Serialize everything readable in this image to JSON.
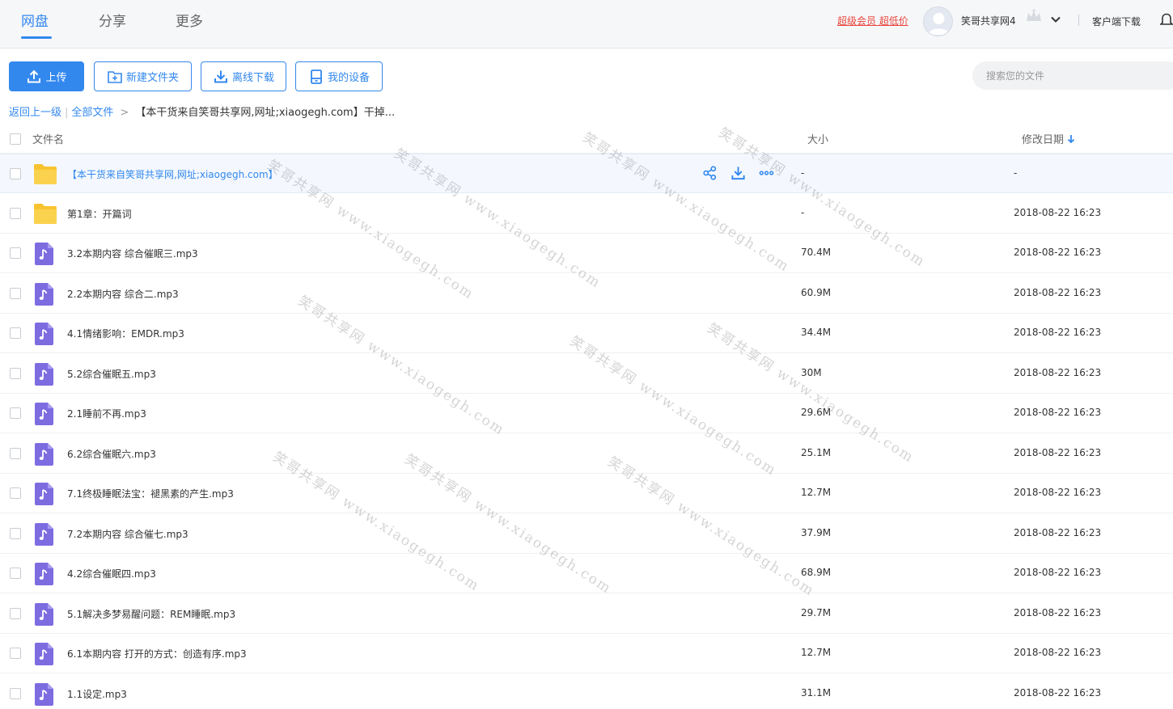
{
  "nav": {
    "tabs": [
      {
        "label": "网盘",
        "active": true
      },
      {
        "label": "分享",
        "active": false
      },
      {
        "label": "更多",
        "active": false
      }
    ],
    "promo": "超级会员 超低价",
    "username": "笑哥共享网4",
    "client_download": "客户端下载"
  },
  "toolbar": {
    "upload": "上传",
    "new_folder": "新建文件夹",
    "offline_download": "离线下载",
    "my_device": "我的设备",
    "search_placeholder": "搜索您的文件"
  },
  "breadcrumb": {
    "back": "返回上一级",
    "all_files": "全部文件",
    "current": "【本干货来自笑哥共享网,网址;xiaogegh.com】干掉..."
  },
  "table": {
    "headers": {
      "name": "文件名",
      "size": "大小",
      "date": "修改日期"
    },
    "rows": [
      {
        "type": "folder",
        "name": "【本干货来自笑哥共享网,网址;xiaogegh.com】",
        "size": "-",
        "date": "-",
        "hovered": true
      },
      {
        "type": "folder",
        "name": "第1章：开篇词",
        "size": "-",
        "date": "2018-08-22 16:23"
      },
      {
        "type": "audio",
        "name": "3.2本期内容 综合催眠三.mp3",
        "size": "70.4M",
        "date": "2018-08-22 16:23"
      },
      {
        "type": "audio",
        "name": "2.2本期内容 综合二.mp3",
        "size": "60.9M",
        "date": "2018-08-22 16:23"
      },
      {
        "type": "audio",
        "name": "4.1情绪影响：EMDR.mp3",
        "size": "34.4M",
        "date": "2018-08-22 16:23"
      },
      {
        "type": "audio",
        "name": "5.2综合催眠五.mp3",
        "size": "30M",
        "date": "2018-08-22 16:23"
      },
      {
        "type": "audio",
        "name": "2.1睡前不再.mp3",
        "size": "29.6M",
        "date": "2018-08-22 16:23"
      },
      {
        "type": "audio",
        "name": "6.2综合催眠六.mp3",
        "size": "25.1M",
        "date": "2018-08-22 16:23"
      },
      {
        "type": "audio",
        "name": "7.1终极睡眠法宝：褪黑素的产生.mp3",
        "size": "12.7M",
        "date": "2018-08-22 16:23"
      },
      {
        "type": "audio",
        "name": "7.2本期内容 综合催七.mp3",
        "size": "37.9M",
        "date": "2018-08-22 16:23"
      },
      {
        "type": "audio",
        "name": "4.2综合催眠四.mp3",
        "size": "68.9M",
        "date": "2018-08-22 16:23"
      },
      {
        "type": "audio",
        "name": "5.1解决多梦易醒问题：REM睡眠.mp3",
        "size": "29.7M",
        "date": "2018-08-22 16:23"
      },
      {
        "type": "audio",
        "name": "6.1本期内容 打开的方式：创造有序.mp3",
        "size": "12.7M",
        "date": "2018-08-22 16:23"
      },
      {
        "type": "audio",
        "name": "1.1设定.mp3",
        "size": "31.1M",
        "date": "2018-08-22 16:23"
      }
    ]
  },
  "watermark_text": "笑哥共享网 www.xiaogegh.com",
  "colors": {
    "accent": "#3388ee",
    "promo": "#e8453c",
    "folder": "#f9c330",
    "audio": "#7c6ce0"
  }
}
